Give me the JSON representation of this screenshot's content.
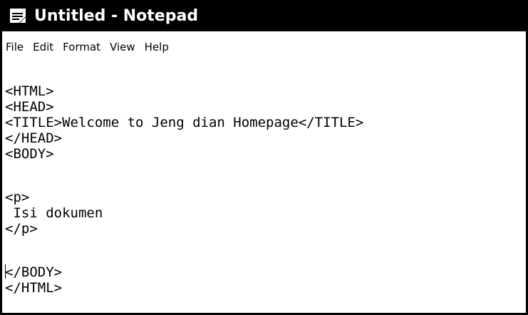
{
  "window": {
    "title": "Untitled - Notepad",
    "app_icon": "notepad-icon"
  },
  "menu": {
    "items": [
      {
        "label": "File"
      },
      {
        "label": "Edit"
      },
      {
        "label": "Format"
      },
      {
        "label": "View"
      },
      {
        "label": "Help"
      }
    ]
  },
  "editor": {
    "lines": [
      "<HTML>",
      "<HEAD>",
      "<TITLE>Welcome to Jeng dian Homepage</TITLE>",
      "</HEAD>",
      "<BODY>",
      "",
      "<p>",
      " Isi dokumen",
      "</p>",
      "",
      "</BODY>",
      "</HTML>"
    ]
  }
}
